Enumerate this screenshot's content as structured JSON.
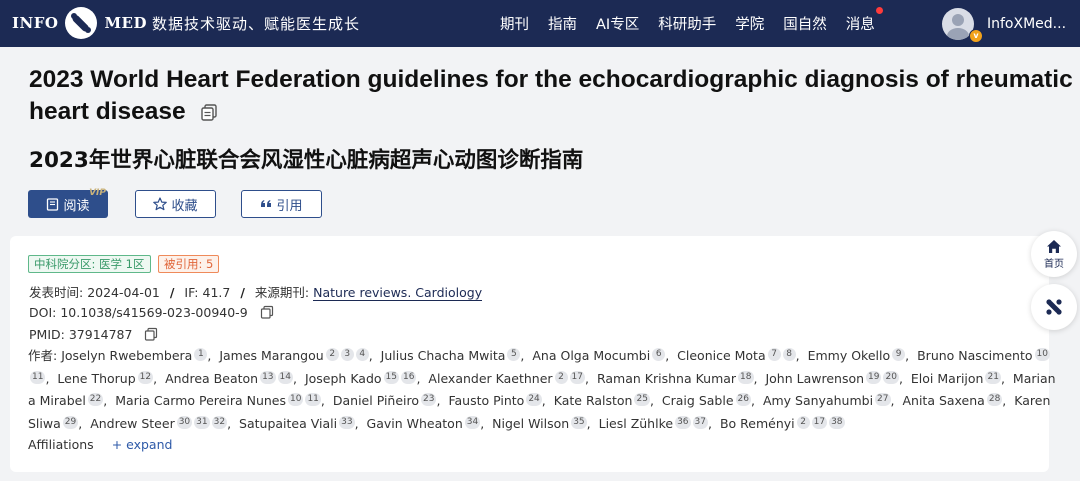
{
  "header": {
    "logo_left": "INFO",
    "logo_right": "MED",
    "slogan": "数据技术驱动、赋能医生成长",
    "nav": [
      "期刊",
      "指南",
      "AI专区",
      "科研助手",
      "学院",
      "国自然",
      "消息"
    ],
    "username": "InfoXMed...",
    "badge": "v",
    "brand_color": "#1c2a54"
  },
  "article": {
    "title_en": "2023 World Heart Federation guidelines for the echocardiographic diagnosis of rheumatic heart disease",
    "title_cn": "2023年世界心脏联合会风湿性心脏病超声心动图诊断指南"
  },
  "actions": {
    "read": "阅读",
    "vip": "VIP",
    "favorite": "收藏",
    "cite": "引用"
  },
  "tags": {
    "zone": "中科院分区: 医学 1区",
    "cited": "被引用: 5"
  },
  "meta": {
    "published_label": "发表时间:",
    "published": "2024-04-01",
    "if_label": "IF:",
    "if_value": "41.7",
    "journal_label": "来源期刊:",
    "journal": "Nature reviews. Cardiology",
    "doi_label": "DOI:",
    "doi": "10.1038/s41569-023-00940-9",
    "pmid_label": "PMID:",
    "pmid": "37914787"
  },
  "authors_label": "作者:",
  "authors": [
    {
      "name": "Joselyn Rwebembera",
      "aff": [
        "1"
      ]
    },
    {
      "name": "James Marangou",
      "aff": [
        "2",
        "3",
        "4"
      ]
    },
    {
      "name": "Julius Chacha Mwita",
      "aff": [
        "5"
      ]
    },
    {
      "name": "Ana Olga Mocumbi",
      "aff": [
        "6"
      ]
    },
    {
      "name": "Cleonice Mota",
      "aff": [
        "7",
        "8"
      ]
    },
    {
      "name": "Emmy Okello",
      "aff": [
        "9"
      ]
    },
    {
      "name": "Bruno Nascimento",
      "aff": [
        "10",
        "11"
      ]
    },
    {
      "name": "Lene Thorup",
      "aff": [
        "12"
      ]
    },
    {
      "name": "Andrea Beaton",
      "aff": [
        "13",
        "14"
      ]
    },
    {
      "name": "Joseph Kado",
      "aff": [
        "15",
        "16"
      ]
    },
    {
      "name": "Alexander Kaethner",
      "aff": [
        "2",
        "17"
      ]
    },
    {
      "name": "Raman Krishna Kumar",
      "aff": [
        "18"
      ]
    },
    {
      "name": "John Lawrenson",
      "aff": [
        "19",
        "20"
      ]
    },
    {
      "name": "Eloi Marijon",
      "aff": [
        "21"
      ]
    },
    {
      "name": "Mariana Mirabel",
      "aff": [
        "22"
      ]
    },
    {
      "name": "Maria Carmo Pereira Nunes",
      "aff": [
        "10",
        "11"
      ]
    },
    {
      "name": "Daniel Piñeiro",
      "aff": [
        "23"
      ]
    },
    {
      "name": "Fausto Pinto",
      "aff": [
        "24"
      ]
    },
    {
      "name": "Kate Ralston",
      "aff": [
        "25"
      ]
    },
    {
      "name": "Craig Sable",
      "aff": [
        "26"
      ]
    },
    {
      "name": "Amy Sanyahumbi",
      "aff": [
        "27"
      ]
    },
    {
      "name": "Anita Saxena",
      "aff": [
        "28"
      ]
    },
    {
      "name": "Karen Sliwa",
      "aff": [
        "29"
      ]
    },
    {
      "name": "Andrew Steer",
      "aff": [
        "30",
        "31",
        "32"
      ]
    },
    {
      "name": "Satupaitea Viali",
      "aff": [
        "33"
      ]
    },
    {
      "name": "Gavin Wheaton",
      "aff": [
        "34"
      ]
    },
    {
      "name": "Nigel Wilson",
      "aff": [
        "35"
      ]
    },
    {
      "name": "Liesl Zühlke",
      "aff": [
        "36",
        "37"
      ]
    },
    {
      "name": "Bo Reményi",
      "aff": [
        "2",
        "17",
        "38"
      ]
    }
  ],
  "affiliations": {
    "label": "Affiliations",
    "expand": "+ expand"
  },
  "float": {
    "home": "首页",
    "home_icon": "home-icon",
    "tool_icon": "tool-icon"
  }
}
